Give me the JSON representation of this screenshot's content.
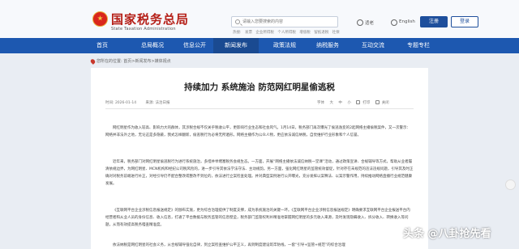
{
  "header": {
    "site_title": "国家税务总局",
    "site_subtitle": "State Taxation Administration",
    "search_placeholder": "请输入您要搜索的内容",
    "hot_words": [
      "热搜:",
      "发票",
      "企业所得税",
      "个人所得税",
      "增值税",
      "留抵退税",
      "社保"
    ],
    "aging_label": "适老",
    "english_label": "English",
    "register_label": "注册",
    "login_label": "登录"
  },
  "nav": {
    "items": [
      "首页",
      "总局概况",
      "信息公开",
      "新闻发布",
      "政策法规",
      "纳税服务",
      "互动交流",
      "专题专栏"
    ]
  },
  "breadcrumb": "您所在的位置:  首页>新闻发布>媒体视点",
  "article": {
    "title": "持续加力 系统施治 防范网红明星偷逃税",
    "date": "时间: 2026-01-14",
    "source": "来源: 法治日报",
    "tools": [
      "字体",
      "大",
      "中",
      "小",
      "打印",
      "关闭"
    ],
    "paragraphs": [
      "网红明星作为收入较高、影响力大的群体，其涉税合规不仅关乎税收公平，更影响行业生态和社会风气。1月14日，税务部门再次曝光了偷逃逸变的2起网络主播偷税案件，又一次警示：网络并非法外之地，无论这是多隐蔽，我式怎样翻新，偷逃税行为必将无所遁形。网络主播作为公众人物，更应依法诚信纳税，自觉维护行业形象和个人信誉。",
      "近年来，税务部门对网红明星偷逃税行为进行系统施治，多措并举堵塞税务会规生态。一方面，开展“网络主播依法诚信纳税一堂课”活动，通过政策宣讲、合规辅导等方式，帮助从业者履清依规边界，为网红明星、MCN机构和经纪公司税风险的，进一步引导其依法学法守法、主动规韵。另一方面，强化网红明星的监管统效督促，针对存在未规范的违法违规问题，引导其及时正确对对税务前端进行补正，对经引导仍不配合整改或整改不到位的，依法进行立案检查处理。并对典型案例进行公开曝光，充分发挥以案释法、以案示警作用，持续推动网络直播行业规范健康发展。",
      "《互联网平台企业涉税信息报送规定》的颁布实施，更为综合治理提供了制度支撑，成为系统施治的关键一环。《互联网平台企业涉税信息报送规定》明确要求互联网平台企业报送平台内经营者和从业人员的身份信息、收入信息，打通了平台数据与税务监管的信息壁垒，税务部门监管权利补精准地掌握网红明星的多元收入来源，及时发现隐瞒收入、拆分收入、转换收入等问题，从而有效提高税务稽查精准度。",
      "依法纳税是网红明星的社会义务，从合规辅导强化自律，到立案检查维护公平正义，再到制度建设筑牢防线，一套“引导+监管+规范”的综合治理"
    ]
  },
  "watermark": "头条 @八卦抢先看"
}
